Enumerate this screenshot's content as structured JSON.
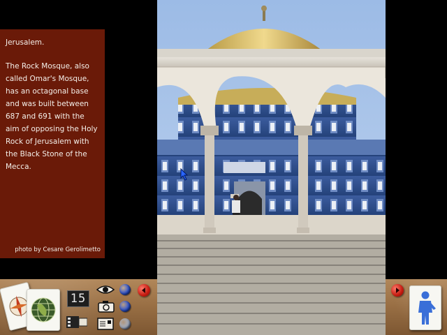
{
  "caption": {
    "title": "Jerusalem.",
    "body": "The Rock Mosque, also\ncalled Omar's Mosque,\nhas an octagonal base\nand was built between\n687 and 691 with the\naim of opposing the Holy\nRock of Jerusalem with\nthe Black Stone of the\nMecca.",
    "credit": "photo by Cesare Gerolimetto"
  },
  "photo": {
    "subject": "dome-of-the-rock"
  },
  "toolbar": {
    "counter": "15",
    "icons": [
      "compass-icon",
      "globe-icon",
      "eye-icon",
      "camera-icon",
      "film-icon",
      "postcard-icon",
      "person-icon"
    ],
    "bead_colors": [
      "#2f56d6",
      "#2f56d6",
      "#a9b3c6"
    ],
    "arrow_color": "#d0241a"
  }
}
